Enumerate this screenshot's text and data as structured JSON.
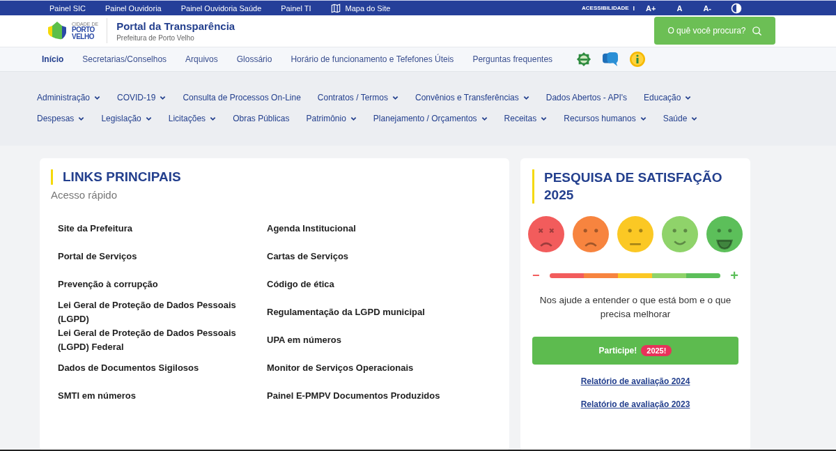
{
  "top_bar": {
    "links": [
      {
        "label": "Painel SIC",
        "kind": "text"
      },
      {
        "label": "Painel Ouvidoria",
        "kind": "text"
      },
      {
        "label": "Painel Ouvidoria Saúde",
        "kind": "text"
      },
      {
        "label": "Painel TI",
        "kind": "text"
      },
      {
        "label": "Mapa do Site",
        "kind": "map"
      }
    ],
    "accessibility": {
      "label": "ACESSIBILIDADE",
      "separator": "I",
      "buttons": [
        "A+",
        "A",
        "A-"
      ]
    }
  },
  "header": {
    "logo": [
      "CIDADE DE",
      "PORTO",
      "VELHO"
    ],
    "title": "Portal da Transparência",
    "subtitle": "Prefeitura de Porto Velho",
    "search_button": "O quê você procura?"
  },
  "nav": {
    "items": [
      {
        "label": "Início",
        "selected": true
      },
      {
        "label": "Secretarias/Conselhos",
        "selected": false
      },
      {
        "label": "Arquivos",
        "selected": false
      },
      {
        "label": "Glossário",
        "selected": false
      },
      {
        "label": "Horário de funcionamento e Tefefones Úteis",
        "selected": false
      },
      {
        "label": "Perguntas frequentes",
        "selected": false
      }
    ],
    "icons": [
      {
        "kind": "badge"
      },
      {
        "kind": "chat"
      },
      {
        "kind": "info"
      }
    ]
  },
  "categories": [
    [
      {
        "label": "Administração",
        "dropdown": true
      },
      {
        "label": "COVID-19",
        "dropdown": true
      },
      {
        "label": "Consulta de Processos On-Line",
        "dropdown": false
      },
      {
        "label": "Contratos / Termos",
        "dropdown": true
      },
      {
        "label": "Convênios e Transferências",
        "dropdown": true
      },
      {
        "label": "Dados Abertos - API's",
        "dropdown": false
      },
      {
        "label": "Educação",
        "dropdown": true
      }
    ],
    [
      {
        "label": "Despesas",
        "dropdown": true
      },
      {
        "label": "Legislação",
        "dropdown": true
      },
      {
        "label": "Licitações",
        "dropdown": true
      },
      {
        "label": "Obras Públicas",
        "dropdown": false
      },
      {
        "label": "Patrimônio",
        "dropdown": true
      },
      {
        "label": "Planejamento / Orçamentos",
        "dropdown": true
      },
      {
        "label": "Receitas",
        "dropdown": true
      },
      {
        "label": "Recursos humanos",
        "dropdown": true
      },
      {
        "label": "Saúde",
        "dropdown": true
      }
    ]
  ],
  "links_card": {
    "title": "LINKS PRINCIPAIS",
    "subtitle": "Acesso rápido",
    "rows": [
      [
        "Site da Prefeitura",
        "Agenda Institucional"
      ],
      [
        "Portal de Serviços",
        "Cartas de Serviços"
      ],
      [
        "Prevenção à corrupção",
        "Código de ética"
      ],
      [
        "Lei Geral de Proteção de Dados Pessoais (LGPD)",
        "Regulamentação da LGPD municipal"
      ],
      [
        "Lei Geral de Proteção de Dados Pessoais (LGPD) Federal",
        "UPA em números"
      ],
      [
        "Dados de Documentos Sigilosos",
        "Monitor de Serviços Operacionais"
      ],
      [
        "SMTI em números",
        "Painel E-PMPV Documentos Produzidos"
      ]
    ]
  },
  "survey": {
    "title": "PESQUISA DE SATISFAÇÃO 2025",
    "faces": [
      {
        "kind": "dead",
        "color": "#f25c5c"
      },
      {
        "kind": "sad",
        "color": "#f7843f"
      },
      {
        "kind": "neutral",
        "color": "#fbc824"
      },
      {
        "kind": "smile",
        "color": "#8fd36a"
      },
      {
        "kind": "happy",
        "color": "#5cbf5a"
      }
    ],
    "minus": "−",
    "plus": "+",
    "text": "Nos ajude a entender o que está bom e o que precisa melhorar",
    "button": "Participe!",
    "badge": "2025!",
    "reports": [
      "Relatório de avaliação 2024",
      "Relatório de avaliação 2023"
    ]
  }
}
